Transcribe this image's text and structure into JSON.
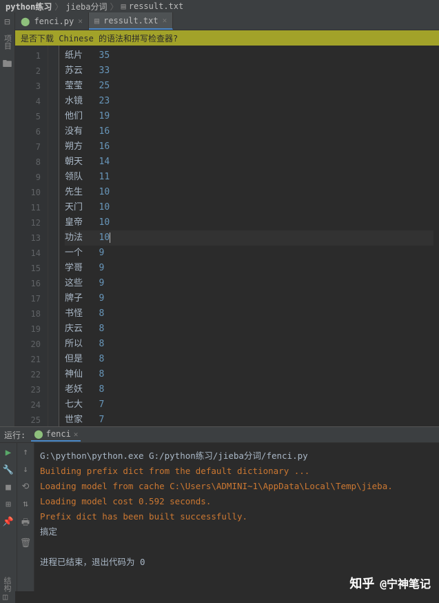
{
  "breadcrumb": {
    "part1": "python练习",
    "part2": "jieba分词",
    "file": "ressult.txt"
  },
  "left_rail": {
    "label": "项目"
  },
  "tabs": [
    {
      "icon": "python",
      "label": "fenci.py",
      "active": false
    },
    {
      "icon": "text",
      "label": "ressult.txt",
      "active": true
    }
  ],
  "notice": "是否下载 Chinese 的语法和拼写检查器?",
  "editor": {
    "cursor_line": 13,
    "lines": [
      {
        "w": "纸片",
        "n": "35"
      },
      {
        "w": "苏云",
        "n": "33"
      },
      {
        "w": "莹莹",
        "n": "25"
      },
      {
        "w": "水镜",
        "n": "23"
      },
      {
        "w": "他们",
        "n": "19"
      },
      {
        "w": "没有",
        "n": "16"
      },
      {
        "w": "朔方",
        "n": "16"
      },
      {
        "w": "朝天",
        "n": "14"
      },
      {
        "w": "领队",
        "n": "11"
      },
      {
        "w": "先生",
        "n": "10"
      },
      {
        "w": "天门",
        "n": "10"
      },
      {
        "w": "皇帝",
        "n": "10"
      },
      {
        "w": "功法",
        "n": "10"
      },
      {
        "w": "一个",
        "n": "9"
      },
      {
        "w": "学哥",
        "n": "9"
      },
      {
        "w": "这些",
        "n": "9"
      },
      {
        "w": "牌子",
        "n": "9"
      },
      {
        "w": "书怪",
        "n": "8"
      },
      {
        "w": "庆云",
        "n": "8"
      },
      {
        "w": "所以",
        "n": "8"
      },
      {
        "w": "但是",
        "n": "8"
      },
      {
        "w": "神仙",
        "n": "8"
      },
      {
        "w": "老妖",
        "n": "8"
      },
      {
        "w": "七大",
        "n": "7"
      },
      {
        "w": "世家",
        "n": "7"
      }
    ]
  },
  "run": {
    "label": "运行:",
    "tab": "fenci"
  },
  "console": {
    "cmd": "G:\\python\\python.exe G:/python练习/jieba分词/fenci.py",
    "l1": "Building prefix dict from the default dictionary ...",
    "l2": "Loading model from cache C:\\Users\\ADMINI~1\\AppData\\Local\\Temp\\jieba.",
    "l3": "Loading model cost 0.592 seconds.",
    "l4": "Prefix dict has been built successfully.",
    "l5": "搞定",
    "exit": "进程已结束，退出代码为 0"
  },
  "bottom_rail": {
    "label": "结构"
  },
  "watermark": {
    "brand": "知乎",
    "author": "@宁神笔记"
  }
}
